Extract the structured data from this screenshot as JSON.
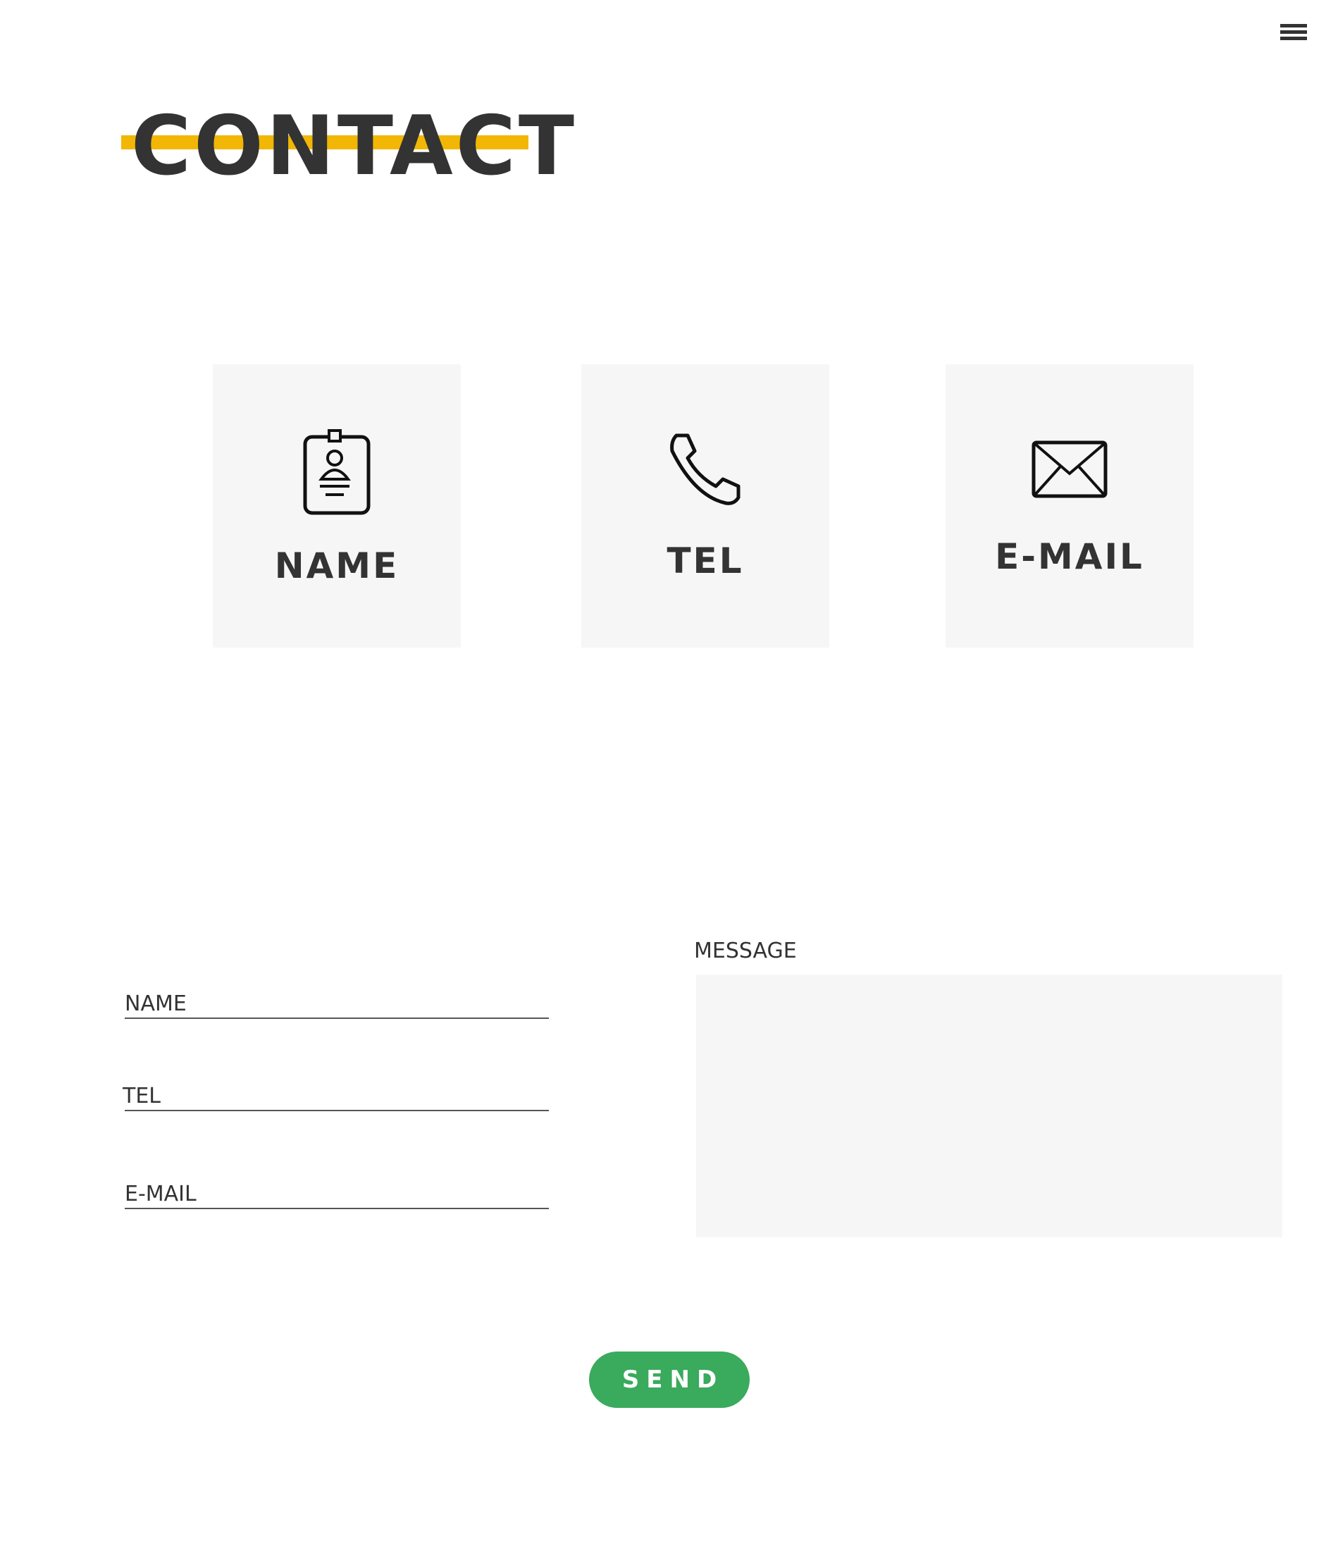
{
  "header": {
    "title": "CONTACT",
    "menu_icon": "hamburger-menu-icon"
  },
  "colors": {
    "accent": "#f2b705",
    "send_button": "#3aaa5c",
    "card_background": "#f6f6f6",
    "text": "#333333"
  },
  "cards": [
    {
      "label": "NAME",
      "icon": "id-badge-icon"
    },
    {
      "label": "TEL",
      "icon": "phone-icon"
    },
    {
      "label": "E-MAIL",
      "icon": "envelope-icon"
    }
  ],
  "form": {
    "name_placeholder": "NAME",
    "tel_placeholder": "TEL",
    "email_placeholder": "E-MAIL",
    "message_label": "MESSAGE",
    "message_value": "",
    "send_label": "SEND"
  }
}
